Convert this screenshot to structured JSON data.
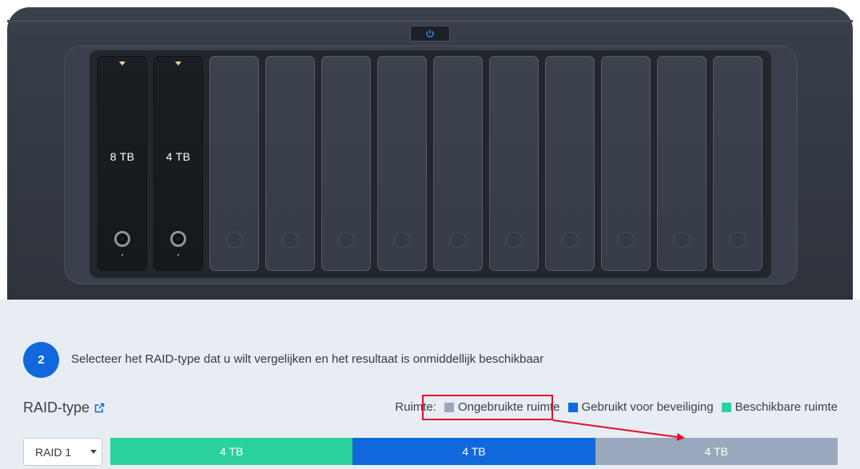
{
  "device": {
    "drives": [
      {
        "capacity": "8 TB"
      },
      {
        "capacity": "4 TB"
      }
    ],
    "empty_bays": 10
  },
  "step": {
    "number": "2",
    "text": "Selecteer het RAID-type dat u wilt vergelijken en het resultaat is onmiddellijk beschikbaar"
  },
  "raid": {
    "label": "RAID-type",
    "selected": "RAID 1"
  },
  "legend": {
    "title": "Ruimte:",
    "items": [
      {
        "label": "Ongebruikte ruimte",
        "color": "#9aa8bd"
      },
      {
        "label": "Gebruikt voor beveiliging",
        "color": "#1068dc"
      },
      {
        "label": "Beschikbare ruimte",
        "color": "#2bd19c"
      }
    ]
  },
  "bar": {
    "segments": [
      {
        "label": "4 TB",
        "color": "#2bd19c"
      },
      {
        "label": "4 TB",
        "color": "#1068dc"
      },
      {
        "label": "4 TB",
        "color": "#9aa8bd"
      }
    ]
  },
  "colors": {
    "accent": "#1068dc",
    "highlight": "#e0102a"
  }
}
